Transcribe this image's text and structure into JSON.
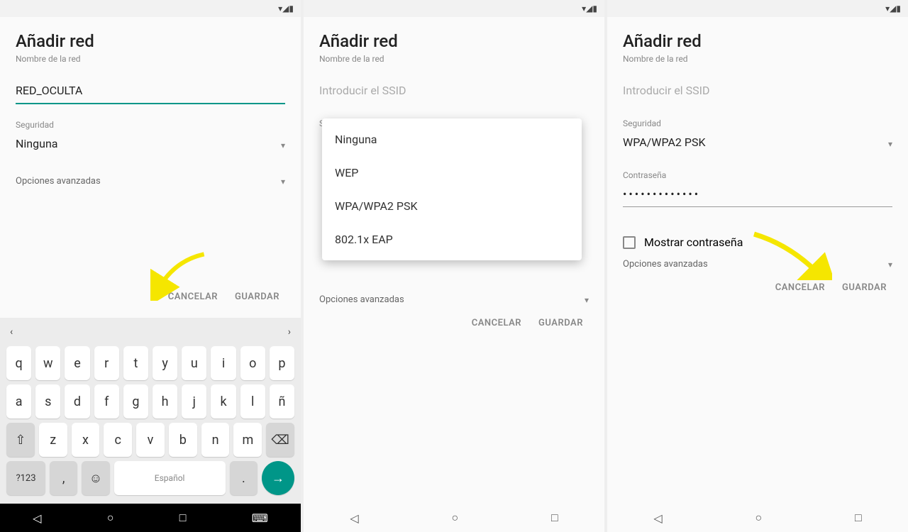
{
  "status": {
    "time": "",
    "icons": "▾◢▮"
  },
  "screen1": {
    "title": "Añadir red",
    "sub": "Nombre de la red",
    "ssid_value": "RED_OCULTA",
    "security_label": "Seguridad",
    "security_value": "Ninguna",
    "advanced": "Opciones avanzadas",
    "cancel": "CANCELAR",
    "save": "GUARDAR",
    "suggestion_center": "",
    "keys_r1": [
      "q",
      "w",
      "e",
      "r",
      "t",
      "y",
      "u",
      "i",
      "o",
      "p"
    ],
    "keys_r2": [
      "a",
      "s",
      "d",
      "f",
      "g",
      "h",
      "j",
      "k",
      "l",
      "ñ"
    ],
    "keys_r3": [
      "⇧",
      "z",
      "x",
      "c",
      "v",
      "b",
      "n",
      "m",
      "⌫"
    ],
    "keys_r4_sym": "?123",
    "keys_r4_emoji": "☺",
    "keys_r4_space": "Español",
    "keys_r4_go": "→"
  },
  "screen2": {
    "title": "Añadir red",
    "sub": "Nombre de la red",
    "ssid_value": "Introducir el SSID",
    "security_label": "Seguridad",
    "popup": [
      "Ninguna",
      "WEP",
      "WPA/WPA2 PSK",
      "802.1x EAP"
    ],
    "advanced": "Opciones avanzadas",
    "cancel": "CANCELAR",
    "save": "GUARDAR"
  },
  "screen3": {
    "title": "Añadir red",
    "sub": "Nombre de la red",
    "ssid_value": "Introducir el SSID",
    "security_label": "Seguridad",
    "security_value": "WPA/WPA2 PSK",
    "password_label": "Contraseña",
    "password_value": "•••••••••••••",
    "show_pwd": "Mostrar contraseña",
    "advanced": "Opciones avanzadas",
    "cancel": "CANCELAR",
    "save": "GUARDAR"
  },
  "nav": {
    "back": "◁",
    "home": "○",
    "recent": "□",
    "kbd": "⌨"
  }
}
